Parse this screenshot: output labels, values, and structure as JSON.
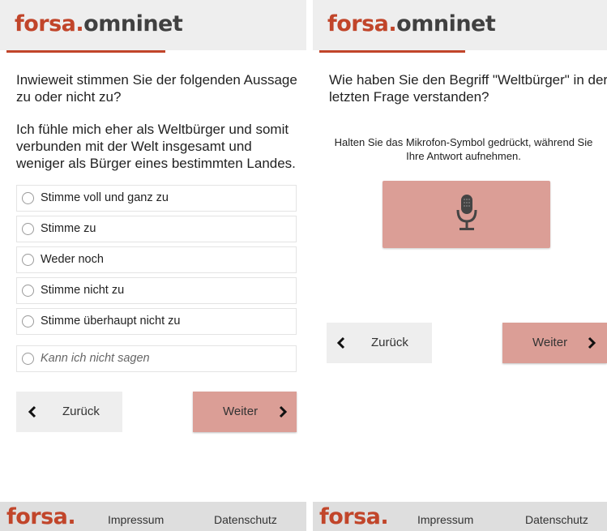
{
  "brand": {
    "part1": "forsa.",
    "part2": "omninet",
    "footer_logo": "forsa.",
    "accent": "#c1452a"
  },
  "left_screen": {
    "question_line1": "Inwieweit stimmen Sie der folgenden Aussage zu oder nicht zu?",
    "statement": "Ich fühle mich eher als Weltbürger und somit verbunden mit der Welt insgesamt und weniger als Bürger eines bestimmten Landes.",
    "options": [
      "Stimme voll und ganz zu",
      "Stimme zu",
      "Weder noch",
      "Stimme nicht zu",
      "Stimme überhaupt nicht zu"
    ],
    "extra_option": "Kann ich nicht sagen",
    "back_label": "Zurück",
    "next_label": "Weiter"
  },
  "right_screen": {
    "question": "Wie haben Sie den Begriff \"Weltbürger\" in der letzten Frage verstanden?",
    "hint": "Halten Sie das Mikrofon-Symbol gedrückt, während Sie Ihre Antwort aufnehmen.",
    "back_label": "Zurück",
    "next_label": "Weiter"
  },
  "footer": {
    "impressum": "Impressum",
    "datenschutz": "Datenschutz"
  },
  "colors": {
    "button_next": "#db9e96",
    "button_back": "#eeeeee",
    "footer_bg": "#dedede"
  },
  "icons": {
    "mic": "microphone-icon",
    "back": "chevron-left-icon",
    "next": "chevron-right-icon"
  }
}
